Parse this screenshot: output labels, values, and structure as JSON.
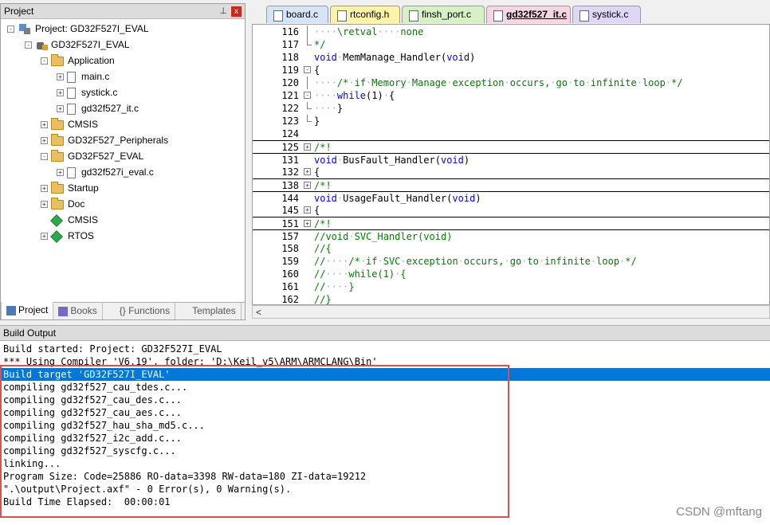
{
  "project_panel": {
    "title": "Project",
    "pin_icon": "📌",
    "close_icon": "x",
    "tree": [
      {
        "label": "Project: GD32F527I_EVAL",
        "icon": "project-icon",
        "expander": "-"
      },
      {
        "label": "GD32F527I_EVAL",
        "icon": "target-icon",
        "expander": "-"
      },
      {
        "label": "Application",
        "icon": "folder-icon",
        "expander": "-"
      },
      {
        "label": "main.c",
        "icon": "file-icon",
        "expander": "+"
      },
      {
        "label": "systick.c",
        "icon": "file-icon",
        "expander": "+"
      },
      {
        "label": "gd32f527_it.c",
        "icon": "file-icon",
        "expander": "+"
      },
      {
        "label": "CMSIS",
        "icon": "folder-icon",
        "expander": "+"
      },
      {
        "label": "GD32F527_Peripherals",
        "icon": "folder-icon",
        "expander": "+"
      },
      {
        "label": "GD32F527_EVAL",
        "icon": "folder-icon",
        "expander": "-"
      },
      {
        "label": "gd32f527i_eval.c",
        "icon": "file-icon",
        "expander": "+"
      },
      {
        "label": "Startup",
        "icon": "folder-icon",
        "expander": "+"
      },
      {
        "label": "Doc",
        "icon": "folder-icon",
        "expander": "+"
      },
      {
        "label": "CMSIS",
        "icon": "package-icon",
        "expander": ""
      },
      {
        "label": "RTOS",
        "icon": "package-icon",
        "expander": "+"
      }
    ],
    "tabs": [
      {
        "label": "Project",
        "icon": "project-tab-icon",
        "active": true
      },
      {
        "label": "Books",
        "icon": "books-icon",
        "active": false
      },
      {
        "label": "{} Functions",
        "icon": "functions-icon",
        "active": false
      },
      {
        "label": "Templates",
        "icon": "templates-icon",
        "active": false
      }
    ]
  },
  "editor": {
    "tabs": [
      {
        "label": "board.c",
        "color": "#d6e4f6",
        "active": false
      },
      {
        "label": "rtconfig.h",
        "color": "#fff3a8",
        "active": false
      },
      {
        "label": "finsh_port.c",
        "color": "#d7f0c4",
        "active": false
      },
      {
        "label": "gd32f527_it.c",
        "color": "#f6d6e4",
        "active": true
      },
      {
        "label": "systick.c",
        "color": "#e0d6f6",
        "active": false
      }
    ],
    "lines": [
      {
        "num": "116",
        "text": "····\\retval····none",
        "fold": "line",
        "style": "cm",
        "sep": false
      },
      {
        "num": "117",
        "text": "*/",
        "fold": "end",
        "style": "cm",
        "sep": false
      },
      {
        "num": "118",
        "text": "void·MemManage_Handler(void)",
        "fold": "",
        "style": "code",
        "sep": false
      },
      {
        "num": "119",
        "text": "{",
        "fold": "-",
        "style": "code",
        "sep": false
      },
      {
        "num": "120",
        "text": "····/*·if·Memory·Manage·exception·occurs,·go·to·infinite·loop·*/",
        "fold": "line",
        "style": "cm",
        "sep": false
      },
      {
        "num": "121",
        "text": "····while(1)·{",
        "fold": "-",
        "style": "code",
        "sep": false
      },
      {
        "num": "122",
        "text": "····}",
        "fold": "end",
        "style": "code",
        "sep": false
      },
      {
        "num": "123",
        "text": "}",
        "fold": "end",
        "style": "code",
        "sep": false
      },
      {
        "num": "124",
        "text": "",
        "fold": "",
        "style": "code",
        "sep": false
      },
      {
        "num": "125",
        "text": "/*!",
        "fold": "+",
        "style": "cm",
        "sep": true
      },
      {
        "num": "131",
        "text": "void·BusFault_Handler(void)",
        "fold": "",
        "style": "code",
        "sep": true
      },
      {
        "num": "132",
        "text": "{",
        "fold": "+",
        "style": "code",
        "sep": false
      },
      {
        "num": "138",
        "text": "/*!",
        "fold": "+",
        "style": "cm",
        "sep": true
      },
      {
        "num": "144",
        "text": "void·UsageFault_Handler(void)",
        "fold": "",
        "style": "code",
        "sep": true
      },
      {
        "num": "145",
        "text": "{",
        "fold": "+",
        "style": "code",
        "sep": false
      },
      {
        "num": "151",
        "text": "/*!",
        "fold": "+",
        "style": "cm",
        "sep": true
      },
      {
        "num": "157",
        "text": "//void·SVC_Handler(void)",
        "fold": "",
        "style": "cm",
        "sep": true
      },
      {
        "num": "158",
        "text": "//{",
        "fold": "",
        "style": "cm",
        "sep": false
      },
      {
        "num": "159",
        "text": "//····/*·if·SVC·exception·occurs,·go·to·infinite·loop·*/",
        "fold": "",
        "style": "cm",
        "sep": false
      },
      {
        "num": "160",
        "text": "//····while(1)·{",
        "fold": "",
        "style": "cm",
        "sep": false
      },
      {
        "num": "161",
        "text": "//····}",
        "fold": "",
        "style": "cm",
        "sep": false
      },
      {
        "num": "162",
        "text": "//}",
        "fold": "",
        "style": "cm",
        "sep": false
      }
    ],
    "scroll_left_icon": "<"
  },
  "build_output": {
    "title": "Build Output",
    "lines": [
      {
        "text": "Build started: Project: GD32F527I_EVAL",
        "selected": false
      },
      {
        "text": "*** Using Compiler 'V6.19', folder: 'D:\\Keil_v5\\ARM\\ARMCLANG\\Bin'",
        "selected": false
      },
      {
        "text": "Build target 'GD32F527I_EVAL'",
        "selected": true
      },
      {
        "text": "compiling gd32f527_cau_tdes.c...",
        "selected": false
      },
      {
        "text": "compiling gd32f527_cau_des.c...",
        "selected": false
      },
      {
        "text": "compiling gd32f527_cau_aes.c...",
        "selected": false
      },
      {
        "text": "compiling gd32f527_hau_sha_md5.c...",
        "selected": false
      },
      {
        "text": "compiling gd32f527_i2c_add.c...",
        "selected": false
      },
      {
        "text": "compiling gd32f527_syscfg.c...",
        "selected": false
      },
      {
        "text": "linking...",
        "selected": false
      },
      {
        "text": "Program Size: Code=25886 RO-data=3398 RW-data=180 ZI-data=19212",
        "selected": false
      },
      {
        "text": "\".\\output\\Project.axf\" - 0 Error(s), 0 Warning(s).",
        "selected": false
      },
      {
        "text": "Build Time Elapsed:  00:00:01",
        "selected": false
      }
    ]
  },
  "watermark": "CSDN @mftang"
}
